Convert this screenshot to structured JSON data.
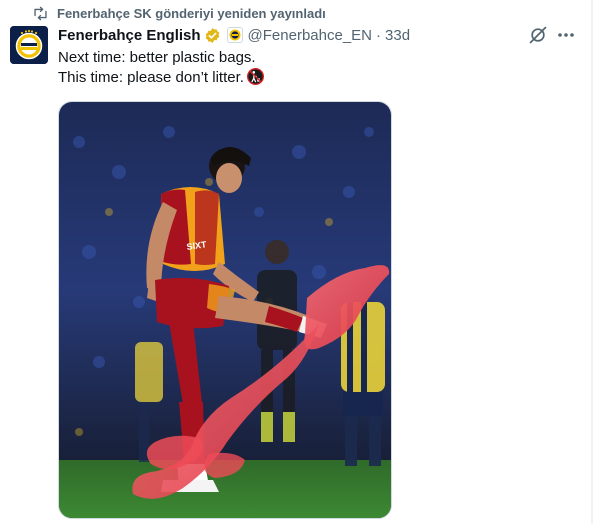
{
  "repost": {
    "icon": "repost-icon",
    "text": "Fenerbahçe SK gönderiyi yeniden yayınladı"
  },
  "tweet": {
    "author_name": "Fenerbahçe English",
    "handle": "@Fenerbahce_EN",
    "separator": "·",
    "time": "33d",
    "text_lines": [
      "Next time: better plastic bags.",
      "This time: please don’t litter."
    ],
    "emoji": "no-littering-emoji"
  },
  "colors": {
    "verified": "#e2b719",
    "secondary_text": "#536471",
    "avatar_bg": "#0b1f49",
    "jersey_red": "#a8121e",
    "jersey_yellow": "#f2a21a",
    "bag_pink": "#ef4b57"
  },
  "icons": {
    "grok": "grok-icon",
    "more": "more-options-icon"
  }
}
